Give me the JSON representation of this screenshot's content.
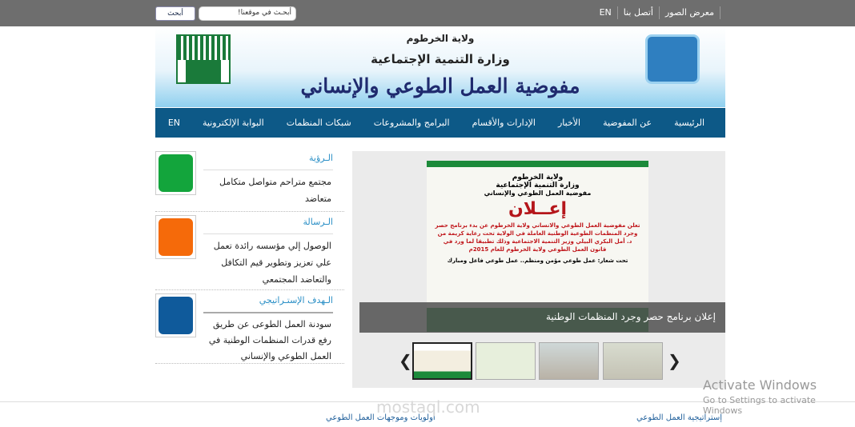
{
  "topbar": {
    "links": [
      "معرض الصور",
      "أتصل بنا",
      "EN"
    ],
    "search_placeholder": "أبحـث في موقعنا!",
    "search_button": "أبحث"
  },
  "banner": {
    "state": "ولاية الخرطوم",
    "ministry": "وزارة التنمية الإجتماعية",
    "commission": "مفوضية العمل الطوعي والإنساني"
  },
  "nav": [
    "الرئيسية",
    "عن المفوضية",
    "الأخبار",
    "الإدارات والأقسام",
    "البرامج والمشروعات",
    "شبكات المنظمات",
    "البوابة الإلكترونية",
    "EN"
  ],
  "sidebar": [
    {
      "title": "الـرؤية",
      "text": "مجتمع متراحم متواصل متكامل متعاضد",
      "color": "#13a53c"
    },
    {
      "title": "الـرسالة",
      "text": "الوصول إلي مؤسسه رائدة تعمل علي تعزيز وتطوير قيم التكافل والتعاضد المجتمعي",
      "color": "#f56a0a"
    },
    {
      "title": "الـهدف الإستـراتيجي",
      "text": "سودنة العمل الطوعى عن طريق رفع قدرات المنظمات الوطنية في العمل الطوعي والإنساني",
      "color": "#0f5a9b"
    }
  ],
  "slider": {
    "ad": {
      "l1": "ولاية الخرطوم",
      "l2": "وزارة التنمية الإجتماعية",
      "l3": "مفوضية العمل الطوعي والإنساني",
      "headline": "إعــلان",
      "body": "تعلن مفوضية العمل الطوعي والانساني ولاية الخرطوم عن بدء برنامج حصر وجرد المنظمات الطوعية الوطنية العاملة في الولاية تحت رعاية كريمة من د. أمل البكري البيلي وزير التنمية الاجتماعية وذلك تطبيقا لما ورد في قانون العمل الطوعي ولاية الخرطوم للعام 2015م",
      "slogan": "تحت شعار: عمل طوعي مؤمن ومنظم.. عمل طوعي فاعل ومبارك"
    },
    "caption": "إعلان برنامج حصر وجرد المنظمات الوطنية"
  },
  "footer": {
    "links": [
      "إستراتيجية العمل الطوعي",
      "أولويات وموجهات العمل الطوعي"
    ]
  },
  "watermark": {
    "activate_title": "Activate Windows",
    "activate_sub": "Go to Settings to activate Windows",
    "mostaql": "mostaql.com"
  }
}
